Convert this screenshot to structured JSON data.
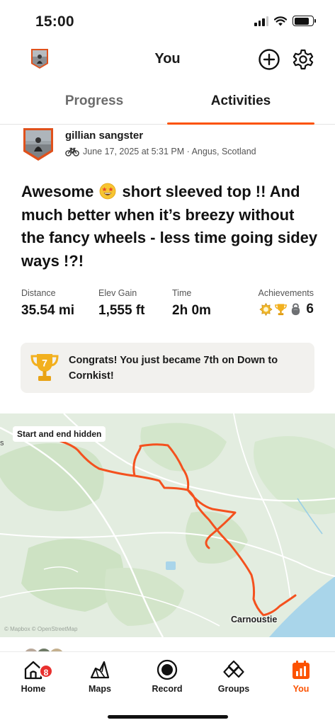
{
  "status_bar": {
    "time": "15:00"
  },
  "header": {
    "title": "You"
  },
  "tabs": [
    {
      "label": "Progress",
      "active": false
    },
    {
      "label": "Activities",
      "active": true
    }
  ],
  "activity": {
    "athlete_name": "gillian sangster",
    "meta": "June 17, 2025 at 5:31 PM · Angus, Scotland",
    "title_part1": "Awesome ",
    "title_part2": " short sleeved top !! And much better when it’s breezy without the fancy wheels - less time going sidey ways !?!",
    "stats": {
      "distance_label": "Distance",
      "distance_value": "35.54 mi",
      "elev_label": "Elev Gain",
      "elev_value": "1,555 ft",
      "time_label": "Time",
      "time_value": "2h 0m",
      "achievements_label": "Achievements",
      "achievements_count": "6"
    },
    "congrats": {
      "rank": "7",
      "text": "Congrats! You just became 7th on Down to Cornkist!"
    },
    "map": {
      "hidden_label": "Start and end hidden",
      "place_label": "Carnoustie",
      "left_edge_text": "s",
      "attribution": "© Mapbox © OpenStreetMap"
    }
  },
  "bottom_nav": {
    "items": [
      {
        "label": "Home",
        "icon": "home-icon",
        "badge": "8"
      },
      {
        "label": "Maps",
        "icon": "maps-icon"
      },
      {
        "label": "Record",
        "icon": "record-icon"
      },
      {
        "label": "Groups",
        "icon": "groups-icon"
      },
      {
        "label": "You",
        "icon": "you-icon",
        "active": true
      }
    ]
  },
  "colors": {
    "accent": "#fc5200",
    "route": "#f4511e",
    "badge": "#e8302e",
    "trophy": "#f2b01e"
  }
}
